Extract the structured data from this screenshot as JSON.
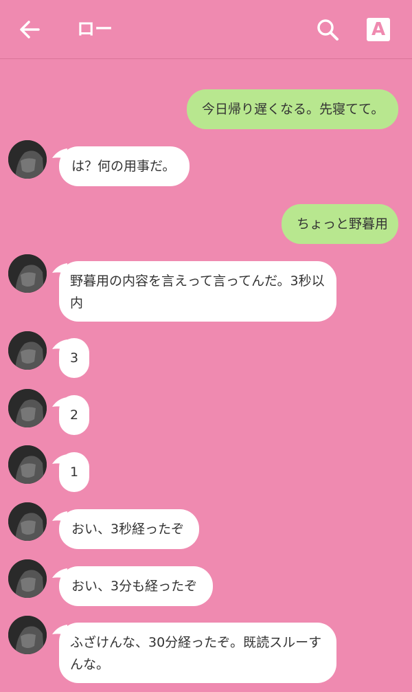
{
  "header": {
    "title": "ロー",
    "font_button_label": "A"
  },
  "colors": {
    "background": "#ef8ab0",
    "incoming_bubble": "#ffffff",
    "outgoing_bubble": "#b8e78f"
  },
  "messages": [
    {
      "from": "me",
      "text": "今日帰り遅くなる。先寝てて。"
    },
    {
      "from": "them",
      "text": "は？何の用事だ。"
    },
    {
      "from": "me",
      "text": "ちょっと野暮用"
    },
    {
      "from": "them",
      "text": "野暮用の内容を言えって言ってんだ。3秒以内"
    },
    {
      "from": "them",
      "text": "3"
    },
    {
      "from": "them",
      "text": "2"
    },
    {
      "from": "them",
      "text": "1"
    },
    {
      "from": "them",
      "text": "おい、3秒経ったぞ"
    },
    {
      "from": "them",
      "text": "おい、3分も経ったぞ"
    },
    {
      "from": "them",
      "text": "ふざけんな、30分経ったぞ。既読スルーすんな。"
    }
  ]
}
